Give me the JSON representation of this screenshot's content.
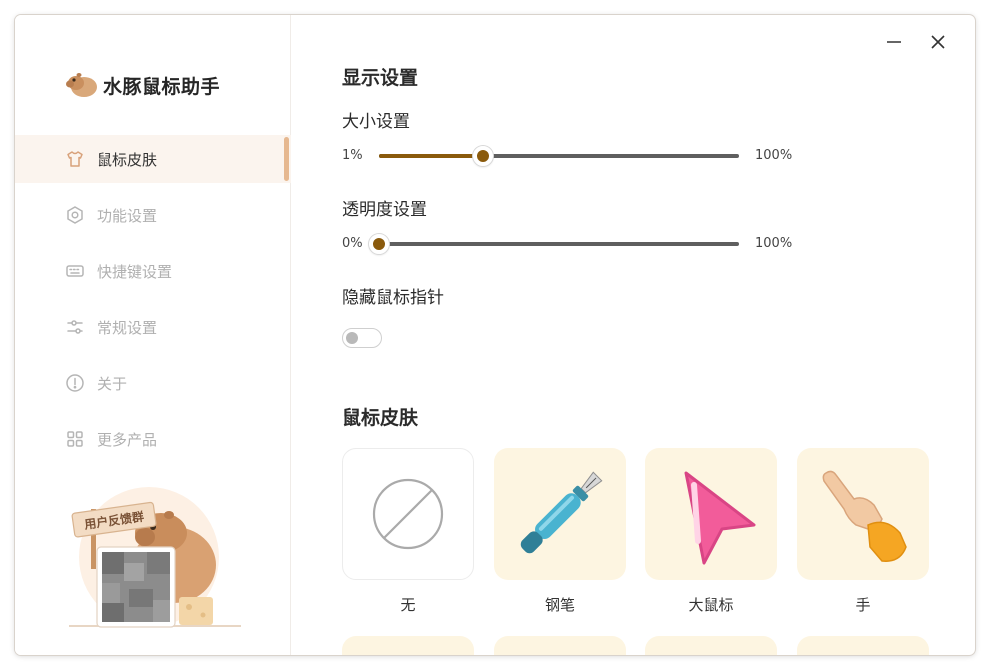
{
  "app": {
    "title": "水豚鼠标助手",
    "accent_color": "#8a5a0c",
    "active_bar_color": "#e6b890"
  },
  "window_controls": {
    "minimize_icon": "minimize-icon",
    "close_icon": "close-icon"
  },
  "sidebar": {
    "items": [
      {
        "label": "鼠标皮肤",
        "icon": "shirt-icon",
        "active": true
      },
      {
        "label": "功能设置",
        "icon": "hexagon-settings-icon",
        "active": false
      },
      {
        "label": "快捷键设置",
        "icon": "keyboard-icon",
        "active": false
      },
      {
        "label": "常规设置",
        "icon": "sliders-icon",
        "active": false
      },
      {
        "label": "关于",
        "icon": "info-icon",
        "active": false
      },
      {
        "label": "更多产品",
        "icon": "grid-icon",
        "active": false
      }
    ],
    "feedback": {
      "sign_text": "用户反馈群",
      "qr_icon": "qr-code-icon"
    }
  },
  "display": {
    "section_title": "显示设置",
    "size": {
      "label": "大小设置",
      "min_label": "1%",
      "max_label": "100%",
      "value_fraction": 0.29
    },
    "opacity": {
      "label": "透明度设置",
      "min_label": "0%",
      "max_label": "100%",
      "value_fraction": 0.0
    },
    "hide_pointer": {
      "label": "隐藏鼠标指针",
      "enabled": false
    }
  },
  "skins": {
    "section_title": "鼠标皮肤",
    "items": [
      {
        "label": "无",
        "icon": "none-icon"
      },
      {
        "label": "钢笔",
        "icon": "fountain-pen-icon"
      },
      {
        "label": "大鼠标",
        "icon": "big-cursor-icon"
      },
      {
        "label": "手",
        "icon": "pointing-hand-icon"
      }
    ]
  }
}
